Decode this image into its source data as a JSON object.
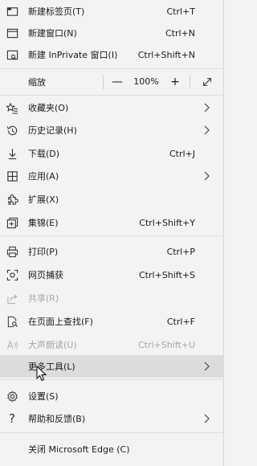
{
  "menu": {
    "new_tab": {
      "label": "新建标签页(T)",
      "shortcut": "Ctrl+T"
    },
    "new_window": {
      "label": "新建窗口(N)",
      "shortcut": "Ctrl+N"
    },
    "new_inprivate": {
      "label": "新建 InPrivate 窗口(I)",
      "shortcut": "Ctrl+Shift+N"
    },
    "zoom": {
      "label": "缩放",
      "minus": "—",
      "value": "100%",
      "plus": "+"
    },
    "favorites": {
      "label": "收藏夹(O)"
    },
    "history": {
      "label": "历史记录(H)"
    },
    "downloads": {
      "label": "下载(D)",
      "shortcut": "Ctrl+J"
    },
    "apps": {
      "label": "应用(A)"
    },
    "extensions": {
      "label": "扩展(X)"
    },
    "collections": {
      "label": "集锦(E)",
      "shortcut": "Ctrl+Shift+Y"
    },
    "print": {
      "label": "打印(P)",
      "shortcut": "Ctrl+P"
    },
    "web_capture": {
      "label": "网页捕获",
      "shortcut": "Ctrl+Shift+S"
    },
    "share": {
      "label": "共享(R)"
    },
    "find": {
      "label": "在页面上查找(F)",
      "shortcut": "Ctrl+F"
    },
    "read_aloud": {
      "label": "大声朗读(U)",
      "shortcut": "Ctrl+Shift+U"
    },
    "more_tools": {
      "label": "更多工具(L)"
    },
    "settings": {
      "label": "设置(S)"
    },
    "help": {
      "label": "帮助和反馈(B)"
    },
    "close": {
      "label": "关闭 Microsoft Edge (C)"
    }
  },
  "icons": [
    "new-tab-icon",
    "new-window-icon",
    "inprivate-icon",
    "expand-icon",
    "favorites-icon",
    "history-icon",
    "download-icon",
    "apps-icon",
    "extensions-icon",
    "collections-icon",
    "print-icon",
    "web-capture-icon",
    "share-icon",
    "find-icon",
    "read-aloud-icon",
    "settings-icon",
    "help-icon",
    "chevron-right-icon"
  ],
  "colors": {
    "background": "#f3f3f3",
    "hover": "#dcdcdc",
    "disabled_text": "#a6a6a6"
  }
}
